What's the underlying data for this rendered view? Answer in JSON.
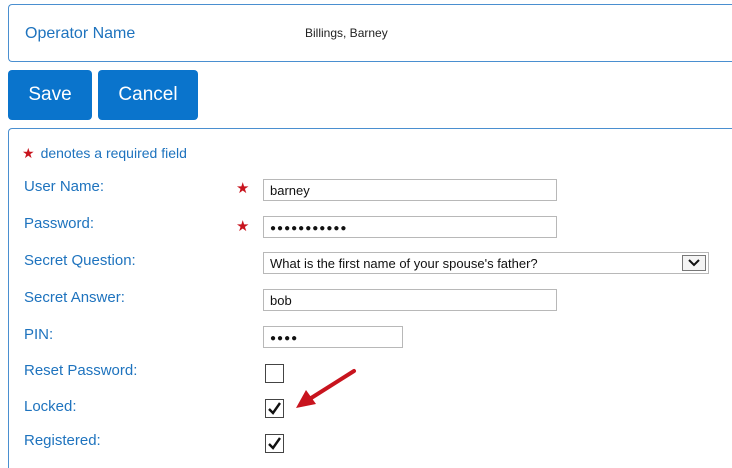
{
  "header": {
    "operator_label": "Operator Name",
    "operator_value": "Billings, Barney"
  },
  "toolbar": {
    "save_label": "Save",
    "cancel_label": "Cancel"
  },
  "form": {
    "required_note": "denotes a required field",
    "required_star": "★",
    "fields": {
      "username": {
        "label": "User Name:",
        "value": "barney",
        "required": true
      },
      "password": {
        "label": "Password:",
        "value": "●●●●●●●●●●●",
        "required": true
      },
      "secret_question": {
        "label": "Secret Question:",
        "value": "What is the first name of your spouse's father?"
      },
      "secret_answer": {
        "label": "Secret Answer:",
        "value": "bob"
      },
      "pin": {
        "label": "PIN:",
        "value": "●●●●"
      },
      "reset_password": {
        "label": "Reset Password:",
        "checked": false
      },
      "locked": {
        "label": "Locked:",
        "checked": true
      },
      "registered": {
        "label": "Registered:",
        "checked": true
      }
    }
  },
  "annotation": {
    "icon": "red-arrow-icon",
    "color": "#c8141e"
  }
}
